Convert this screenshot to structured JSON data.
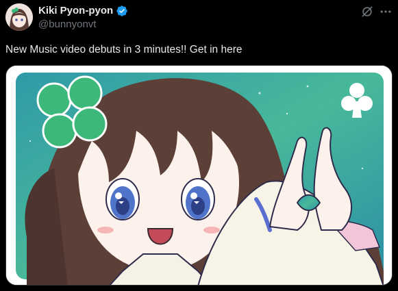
{
  "post": {
    "display_name": "Kiki Pyon-pyon",
    "handle": "@bunnyonvt",
    "text": "New Music video debuts in 3 minutes!! Get in here",
    "verified": true,
    "icons": {
      "verified": "verified-badge-icon",
      "grok": "grok-icon",
      "more": "more-options-icon",
      "club": "club-suit-icon"
    }
  },
  "colors": {
    "background": "#000000",
    "text_primary": "#e7e9ea",
    "text_secondary": "#71767b",
    "verified_blue": "#1d9bf0",
    "clover_green": "#3cb97a",
    "media_bg_teal": "#3fae9a"
  }
}
